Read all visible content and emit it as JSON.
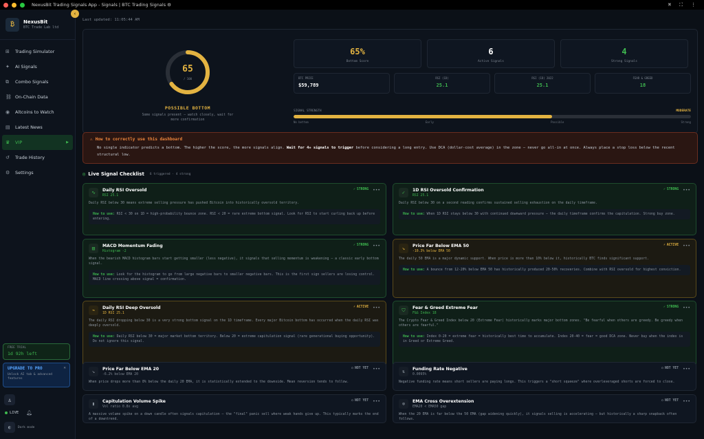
{
  "window": {
    "title": "NexusBit Trading Signals App - Signals | BTC Trading Signals ⚙"
  },
  "sidebar": {
    "brand_name": "NexusBit",
    "brand_sub": "BTC Trade Lab ltd",
    "items": [
      {
        "label": "Trading Simulator",
        "icon": "chart-icon"
      },
      {
        "label": "AI Signals",
        "icon": "ai-icon"
      },
      {
        "label": "Combo Signals",
        "icon": "combo-icon"
      },
      {
        "label": "On-Chain Data",
        "icon": "chain-icon"
      },
      {
        "label": "Altcoins to Watch",
        "icon": "eye-icon"
      },
      {
        "label": "Latest News",
        "icon": "news-icon"
      },
      {
        "label": "VIP",
        "icon": "crown-icon"
      },
      {
        "label": "Trade History",
        "icon": "history-icon"
      },
      {
        "label": "Settings",
        "icon": "gear-icon"
      }
    ],
    "trial_label": "FREE TRIAL",
    "trial_value": "1d 92h left",
    "upgrade_title": "UPGRADE TO PRO",
    "upgrade_desc": "Unlock AI tab & advanced features",
    "live_label": "LIVE",
    "mode_label": "Dark mode"
  },
  "main": {
    "last_updated": "Last updated: 11:05:44 AM",
    "score": {
      "value": "65",
      "sub": "/ 100",
      "fraction": 0.65,
      "label": "POSSIBLE BOTTOM",
      "desc": "Some signals present — watch closely, wait for more confirmation"
    },
    "stats": [
      {
        "value": "65%",
        "label": "Bottom Score",
        "color": "#e3b341"
      },
      {
        "value": "6",
        "label": "Active Signals",
        "color": "#ffffff"
      },
      {
        "value": "4",
        "label": "Strong Signals",
        "color": "#3fb950"
      }
    ],
    "minis": [
      {
        "label": "BTC PRICE",
        "value": "$59,789",
        "color": "#ffffff"
      },
      {
        "label": "RSI (1D)",
        "value": "25.1",
        "color": "#3fb950"
      },
      {
        "label": "RSI (1D) 2022",
        "value": "25.1",
        "color": "#3fb950"
      },
      {
        "label": "FEAR & GREED",
        "value": "18",
        "color": "#3fb950"
      }
    ],
    "strength": {
      "label": "SIGNAL STRENGTH",
      "value": "MODERATE",
      "fraction": 0.65,
      "ticks": [
        "No bottom",
        "Early",
        "Possible",
        "Strong"
      ]
    },
    "warning": {
      "title": "How to correctly use this dashboard",
      "body_pre": "No single indicator predicts a bottom. The higher the score, the more signals align. ",
      "body_bold": "Wait for 4+ signals to trigger",
      "body_post": " before considering a long entry. Use DCA (dollar-cost average) in the zone — never go all-in at once. Always place a stop loss below the recent structural low."
    },
    "checklist": {
      "title": "Live Signal Checklist",
      "subtitle": "6 triggered · 4 strong"
    },
    "cards": [
      {
        "title": "Daily RSI Oversold",
        "sub": "RSI 25.1",
        "badge": "STRONG",
        "tone": "g",
        "icon": "rsi-icon",
        "desc": "Daily RSI below 30 means extreme selling pressure has pushed Bitcoin into historically oversold territory.",
        "how": "RSI < 30 on 1D = high-probability bounce zone. RSI < 20 = rare extreme bottom signal. Look for RSI to start curling back up before entering."
      },
      {
        "title": "1D RSI Oversold Confirmation",
        "sub": "RSI 25.1",
        "badge": "STRONG",
        "tone": "g",
        "icon": "check-icon",
        "desc": "Daily RSI below 30 on a second reading confirms sustained selling exhaustion on the daily timeframe.",
        "how": "When 1D RSI stays below 30 with continued downward pressure — the daily timeframe confirms the capitulation. Strong buy zone."
      },
      {
        "title": "MACD Momentum Fading",
        "sub": "Histogram -2",
        "badge": "STRONG",
        "tone": "g",
        "icon": "histogram-icon",
        "desc": "When the bearish MACD histogram bars start getting smaller (less negative), it signals that selling momentum is weakening — a classic early bottom signal.",
        "how": "Look for the histogram to go from large negative bars to smaller negative bars. This is the first sign sellers are losing control. MACD line crossing above signal = confirmation."
      },
      {
        "title": "Price Far Below EMA 50",
        "sub": "-10.3% below EMA 50",
        "badge": "ACTIVE",
        "tone": "y",
        "icon": "trend-icon",
        "desc": "The daily 50 EMA is a major dynamic support. When price is more than 10% below it, historically BTC finds significant support.",
        "how": "A bounce from 12-20% below EMA 50 has historically produced 20-50% recoveries. Combine with RSI oversold for highest conviction."
      },
      {
        "title": "Daily RSI Deep Oversold",
        "sub": "1D RSI 25.1",
        "badge": "ACTIVE",
        "tone": "y",
        "icon": "pulse-icon",
        "desc": "The daily RSI dropping below 30 is a very strong bottom signal on the 1D timeframe. Every major Bitcoin bottom has occurred when the daily RSI was deeply oversold.",
        "how": "Daily RSI below 30 = major market bottom territory. Below 20 = extreme capitulation signal (rare generational buying opportunity). Do not ignore this signal."
      },
      {
        "title": "Fear & Greed Extreme Fear",
        "sub": "F&G Index 18",
        "badge": "STRONG",
        "tone": "g",
        "icon": "shield-icon",
        "desc": "The Crypto Fear & Greed Index below 20 (Extreme Fear) historically marks major bottom zones. \"Be fearful when others are greedy. Be greedy when others are fearful.\"",
        "how": "Index 0-20 = extreme fear = historically best time to accumulate. Index 20-40 = fear = good DCA zone. Never buy when the index is in Greed or Extreme Greed."
      },
      {
        "title": "Price Far Below EMA 20",
        "sub": "-6.2% below EMA 20",
        "badge": "NOT YET",
        "tone": "n",
        "icon": "trend-icon",
        "desc": "When price drops more than 8% below the daily 20 EMA, it is statistically extended to the downside. Mean reversion tends to follow."
      },
      {
        "title": "Funding Rate Negative",
        "sub": "0.0095%",
        "badge": "NOT YET",
        "tone": "n",
        "icon": "funding-icon",
        "desc": "Negative funding rate means short sellers are paying longs. This triggers a \"short squeeze\" where overleveraged shorts are forced to close."
      },
      {
        "title": "Capitulation Volume Spike",
        "sub": "Vol ratio 0.8x avg",
        "badge": "NOT YET",
        "tone": "n",
        "icon": "volume-icon",
        "desc": "A massive volume spike on a down candle often signals capitulation — the \"final\" panic sell where weak hands give up. This typically marks the end of a downtrend."
      },
      {
        "title": "EMA Cross Overextension",
        "sub": "EMA20 < EMA50 gap",
        "badge": "NOT YET",
        "tone": "n",
        "icon": "cross-icon",
        "desc": "When the 20 EMA is far below the 50 EMA (gap widening quickly), it signals selling is accelerating — but historically a sharp snapback often follows."
      }
    ],
    "how_label": "How to use:"
  }
}
